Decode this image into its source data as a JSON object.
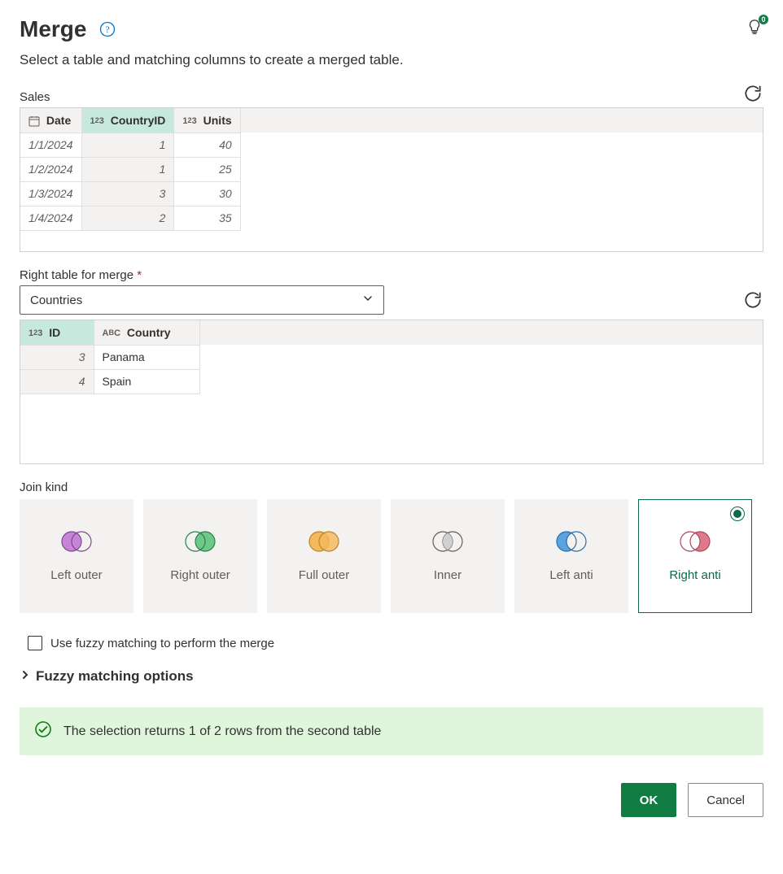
{
  "header": {
    "title": "Merge",
    "badge_count": "0",
    "subtitle": "Select a table and matching columns to create a merged table."
  },
  "left_table": {
    "label": "Sales",
    "cols": [
      {
        "name": "Date",
        "type": "date",
        "selected": false
      },
      {
        "name": "CountryID",
        "type": "number",
        "selected": true
      },
      {
        "name": "Units",
        "type": "number",
        "selected": false
      }
    ],
    "rows": [
      {
        "Date": "1/1/2024",
        "CountryID": "1",
        "Units": "40"
      },
      {
        "Date": "1/2/2024",
        "CountryID": "1",
        "Units": "25"
      },
      {
        "Date": "1/3/2024",
        "CountryID": "3",
        "Units": "30"
      },
      {
        "Date": "1/4/2024",
        "CountryID": "2",
        "Units": "35"
      }
    ]
  },
  "right_table": {
    "label": "Right table for merge",
    "selected": "Countries",
    "cols": [
      {
        "name": "ID",
        "type": "number",
        "selected": true
      },
      {
        "name": "Country",
        "type": "text",
        "selected": false
      }
    ],
    "rows": [
      {
        "ID": "3",
        "Country": "Panama"
      },
      {
        "ID": "4",
        "Country": "Spain"
      }
    ]
  },
  "join": {
    "label": "Join kind",
    "options": [
      {
        "key": "left-outer",
        "label": "Left outer"
      },
      {
        "key": "right-outer",
        "label": "Right outer"
      },
      {
        "key": "full-outer",
        "label": "Full outer"
      },
      {
        "key": "inner",
        "label": "Inner"
      },
      {
        "key": "left-anti",
        "label": "Left anti"
      },
      {
        "key": "right-anti",
        "label": "Right anti"
      }
    ],
    "selected": "right-anti"
  },
  "fuzzy": {
    "checkbox_label": "Use fuzzy matching to perform the merge",
    "options_label": "Fuzzy matching options"
  },
  "status": {
    "message": "The selection returns 1 of 2 rows from the second table"
  },
  "buttons": {
    "ok": "OK",
    "cancel": "Cancel"
  }
}
